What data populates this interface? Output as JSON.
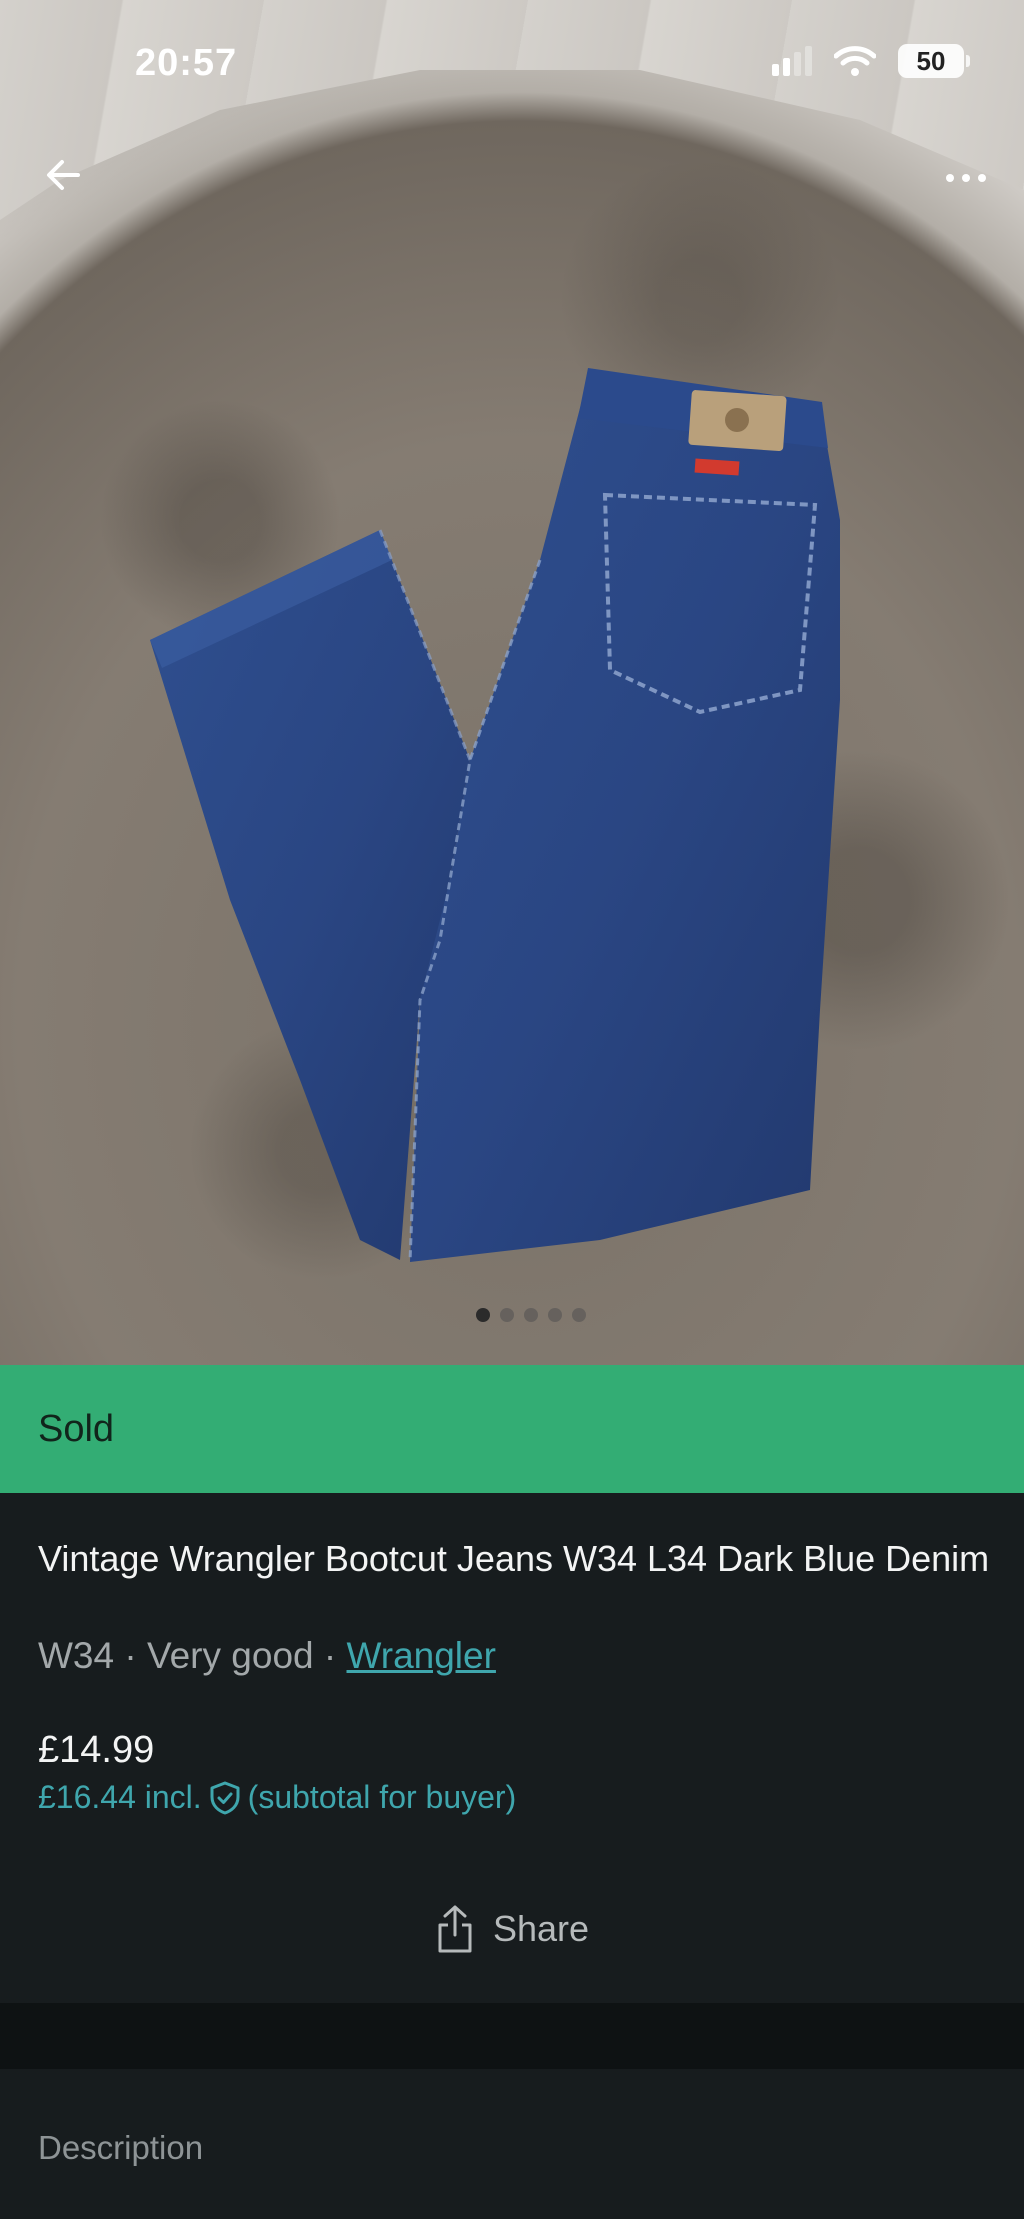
{
  "status_bar": {
    "time": "20:57",
    "battery": "50"
  },
  "gallery": {
    "image_alt": "Dark blue Wrangler jeans on a grey rug",
    "page_count": 5,
    "active_page": 1
  },
  "banner": {
    "label": "Sold",
    "color": "#33ad74"
  },
  "item": {
    "title": "Vintage Wrangler Bootcut Jeans W34 L34 Dark Blue Denim",
    "size": "W34",
    "separator": "·",
    "condition": "Very good",
    "brand": "Wrangler",
    "price": "£14.99",
    "price_incl": "£16.44 incl.",
    "subtotal_note": "(subtotal for buyer)"
  },
  "actions": {
    "share_label": "Share"
  },
  "sections": {
    "description_label": "Description"
  },
  "colors": {
    "accent": "#3fa6ad",
    "background": "#171c1e"
  }
}
